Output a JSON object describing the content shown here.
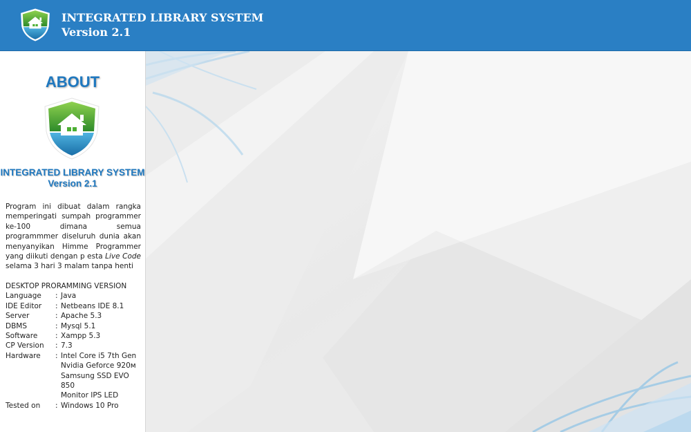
{
  "header": {
    "title": "INTEGRATED LIBRARY SYSTEM",
    "version": "Version 2.1",
    "logo_icon": "shield-house-icon"
  },
  "sidebar": {
    "about_title": "ABOUT",
    "app_name": "INTEGRATED LIBRARY SYSTEM",
    "app_version": "Version 2.1",
    "description_before": "Program ini dibuat dalam rangka memperingati sumpah programmer ke-100 dimana semua programmmer diseluruh dunia akan menyanyikan Himme Programmer yang diikuti dengan p esta ",
    "description_italic": "Live Code",
    "description_after": " selama 3 hari 3 malam tanpa henti",
    "specs_heading": "DESKTOP PRORAMMING VERSION",
    "specs": [
      {
        "key": "Language",
        "values": [
          "Java"
        ]
      },
      {
        "key": "IDE Editor",
        "values": [
          "Netbeans IDE 8.1"
        ]
      },
      {
        "key": "Server",
        "values": [
          "Apache 5.3"
        ]
      },
      {
        "key": "DBMS",
        "values": [
          "Mysql 5.1"
        ]
      },
      {
        "key": "Software",
        "values": [
          "Xampp 5.3"
        ]
      },
      {
        "key": "CP Version",
        "values": [
          "7.3"
        ]
      },
      {
        "key": "Hardware",
        "values": [
          "Intel Core i5 7th Gen",
          "Nvidia Geforce 920м",
          "Samsung SSD EVO 850",
          "Monitor IPS LED"
        ]
      },
      {
        "key": "Tested on",
        "values": [
          "Windows 10 Pro"
        ]
      }
    ],
    "separator": ":"
  },
  "colors": {
    "header_bg": "#2a7fc4",
    "accent_blue": "#1f78bf",
    "shield_green": "#4cae32",
    "content_bg": "#f0f0f0"
  }
}
